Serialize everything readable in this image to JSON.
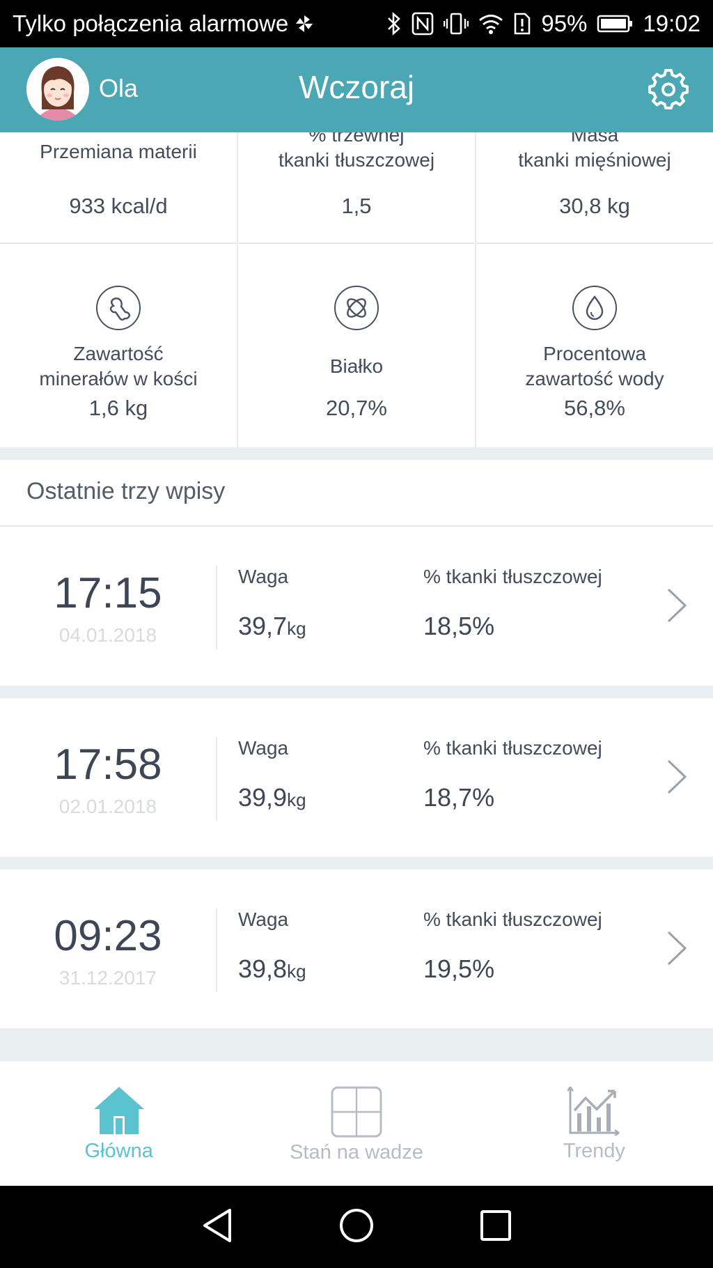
{
  "statusbar": {
    "carrier": "Tylko połączenia alarmowe",
    "battery": "95%",
    "time": "19:02"
  },
  "header": {
    "username": "Ola",
    "title": "Wczoraj",
    "accent_color": "#4aa7b3"
  },
  "metrics_top": [
    {
      "label": "Przemiana materii",
      "value": "933 kcal/d"
    },
    {
      "label_l1": "% trzewnej",
      "label_l2": "tkanki tłuszczowej",
      "value": "1,5"
    },
    {
      "label_l1": "Masa",
      "label_l2": "tkanki mięśniowej",
      "value": "30,8 kg"
    }
  ],
  "metrics_bottom": [
    {
      "icon": "bone-icon",
      "label_l1": "Zawartość",
      "label_l2": "minerałów w kości",
      "value": "1,6 kg"
    },
    {
      "icon": "protein-icon",
      "label": "Białko",
      "value": "20,7%"
    },
    {
      "icon": "water-drop-icon",
      "label_l1": "Procentowa",
      "label_l2": "zawartość wody",
      "value": "56,8%"
    }
  ],
  "recent": {
    "title": "Ostatnie trzy wpisy",
    "weight_label": "Waga",
    "fat_label": "% tkanki tłuszczowej",
    "unit": "kg",
    "entries": [
      {
        "time": "17:15",
        "date": "04.01.2018",
        "weight": "39,7",
        "fat": "18,5%"
      },
      {
        "time": "17:58",
        "date": "02.01.2018",
        "weight": "39,9",
        "fat": "18,7%"
      },
      {
        "time": "09:23",
        "date": "31.12.2017",
        "weight": "39,8",
        "fat": "19,5%"
      }
    ]
  },
  "bottomnav": [
    {
      "label": "Główna",
      "icon": "home-icon",
      "active": true
    },
    {
      "label": "Stań na wadze",
      "icon": "scale-icon",
      "active": false
    },
    {
      "label": "Trendy",
      "icon": "trend-chart-icon",
      "active": false
    }
  ]
}
